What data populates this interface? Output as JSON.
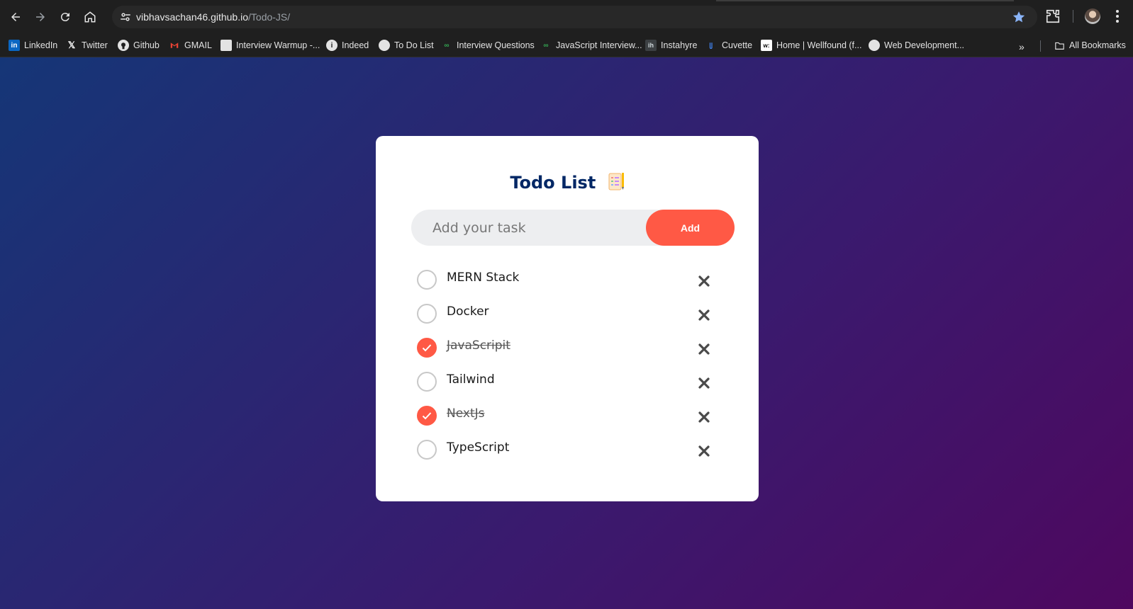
{
  "browser": {
    "url_host": "vibhavsachan46.github.io",
    "url_path": "/Todo-JS/",
    "bookmarks": [
      {
        "label": "LinkedIn",
        "icon": "linkedin-icon"
      },
      {
        "label": "Twitter",
        "icon": "x-icon"
      },
      {
        "label": "Github",
        "icon": "github-icon"
      },
      {
        "label": "GMAIL",
        "icon": "gmail-icon"
      },
      {
        "label": "Interview Warmup -...",
        "icon": "google-doc-icon"
      },
      {
        "label": "Indeed",
        "icon": "info-icon"
      },
      {
        "label": "To Do List",
        "icon": "globe-icon"
      },
      {
        "label": "Interview Questions",
        "icon": "infinity-icon"
      },
      {
        "label": "JavaScript Interview...",
        "icon": "infinity-icon"
      },
      {
        "label": "Instahyre",
        "icon": "ih-icon"
      },
      {
        "label": "Cuvette",
        "icon": "cuvette-icon"
      },
      {
        "label": "Home | Wellfound (f...",
        "icon": "wellfound-icon"
      },
      {
        "label": "Web Development...",
        "icon": "w3-icon"
      }
    ],
    "more_label": "»",
    "all_bookmarks": "All Bookmarks"
  },
  "app": {
    "title": "Todo List",
    "input_placeholder": "Add your task",
    "input_value": "",
    "add_label": "Add",
    "tasks": [
      {
        "text": "MERN Stack",
        "done": false
      },
      {
        "text": "Docker",
        "done": false
      },
      {
        "text": "JavaScripit",
        "done": true
      },
      {
        "text": "Tailwind",
        "done": false
      },
      {
        "text": "NextJs",
        "done": true
      },
      {
        "text": "TypeScript",
        "done": false
      }
    ]
  },
  "colors": {
    "accent": "#ff5945",
    "title": "#002765",
    "bg_start": "#153677",
    "bg_end": "#4e085f"
  }
}
